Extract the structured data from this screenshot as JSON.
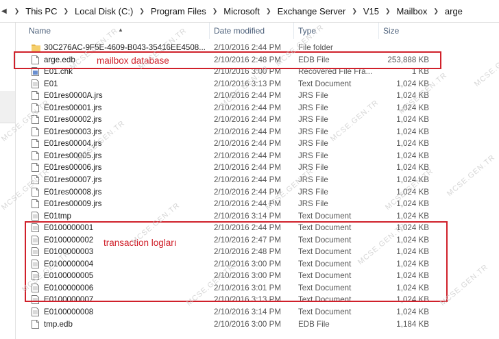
{
  "breadcrumb": [
    "This PC",
    "Local Disk (C:)",
    "Program Files",
    "Microsoft",
    "Exchange Server",
    "V15",
    "Mailbox",
    "arge"
  ],
  "columns": {
    "name": "Name",
    "date": "Date modified",
    "type": "Type",
    "size": "Size"
  },
  "files": [
    {
      "name": "30C276AC-9F5E-4609-B043-35416EE4508...",
      "date": "2/10/2016 2:44 PM",
      "type": "File folder",
      "size": "",
      "icon": "folder-icon"
    },
    {
      "name": "arge.edb",
      "date": "2/10/2016 2:48 PM",
      "type": "EDB File",
      "size": "253,888 KB",
      "icon": "file-icon"
    },
    {
      "name": "E01.chk",
      "date": "2/10/2016 3:00 PM",
      "type": "Recovered File Fra...",
      "size": "1 KB",
      "icon": "recovered-file-icon"
    },
    {
      "name": "E01",
      "date": "2/10/2016 3:13 PM",
      "type": "Text Document",
      "size": "1,024 KB",
      "icon": "text-document-icon"
    },
    {
      "name": "E01res0000A.jrs",
      "date": "2/10/2016 2:44 PM",
      "type": "JRS File",
      "size": "1,024 KB",
      "icon": "file-icon"
    },
    {
      "name": "E01res00001.jrs",
      "date": "2/10/2016 2:44 PM",
      "type": "JRS File",
      "size": "1,024 KB",
      "icon": "file-icon"
    },
    {
      "name": "E01res00002.jrs",
      "date": "2/10/2016 2:44 PM",
      "type": "JRS File",
      "size": "1,024 KB",
      "icon": "file-icon"
    },
    {
      "name": "E01res00003.jrs",
      "date": "2/10/2016 2:44 PM",
      "type": "JRS File",
      "size": "1,024 KB",
      "icon": "file-icon"
    },
    {
      "name": "E01res00004.jrs",
      "date": "2/10/2016 2:44 PM",
      "type": "JRS File",
      "size": "1,024 KB",
      "icon": "file-icon"
    },
    {
      "name": "E01res00005.jrs",
      "date": "2/10/2016 2:44 PM",
      "type": "JRS File",
      "size": "1,024 KB",
      "icon": "file-icon"
    },
    {
      "name": "E01res00006.jrs",
      "date": "2/10/2016 2:44 PM",
      "type": "JRS File",
      "size": "1,024 KB",
      "icon": "file-icon"
    },
    {
      "name": "E01res00007.jrs",
      "date": "2/10/2016 2:44 PM",
      "type": "JRS File",
      "size": "1,024 KB",
      "icon": "file-icon"
    },
    {
      "name": "E01res00008.jrs",
      "date": "2/10/2016 2:44 PM",
      "type": "JRS File",
      "size": "1,024 KB",
      "icon": "file-icon"
    },
    {
      "name": "E01res00009.jrs",
      "date": "2/10/2016 2:44 PM",
      "type": "JRS File",
      "size": "1,024 KB",
      "icon": "file-icon"
    },
    {
      "name": "E01tmp",
      "date": "2/10/2016 3:14 PM",
      "type": "Text Document",
      "size": "1,024 KB",
      "icon": "text-document-icon"
    },
    {
      "name": "E0100000001",
      "date": "2/10/2016 2:44 PM",
      "type": "Text Document",
      "size": "1,024 KB",
      "icon": "text-document-icon"
    },
    {
      "name": "E0100000002",
      "date": "2/10/2016 2:47 PM",
      "type": "Text Document",
      "size": "1,024 KB",
      "icon": "text-document-icon"
    },
    {
      "name": "E0100000003",
      "date": "2/10/2016 2:48 PM",
      "type": "Text Document",
      "size": "1,024 KB",
      "icon": "text-document-icon"
    },
    {
      "name": "E0100000004",
      "date": "2/10/2016 3:00 PM",
      "type": "Text Document",
      "size": "1,024 KB",
      "icon": "text-document-icon"
    },
    {
      "name": "E0100000005",
      "date": "2/10/2016 3:00 PM",
      "type": "Text Document",
      "size": "1,024 KB",
      "icon": "text-document-icon"
    },
    {
      "name": "E0100000006",
      "date": "2/10/2016 3:01 PM",
      "type": "Text Document",
      "size": "1,024 KB",
      "icon": "text-document-icon"
    },
    {
      "name": "E0100000007",
      "date": "2/10/2016 3:13 PM",
      "type": "Text Document",
      "size": "1,024 KB",
      "icon": "text-document-icon"
    },
    {
      "name": "E0100000008",
      "date": "2/10/2016 3:14 PM",
      "type": "Text Document",
      "size": "1,024 KB",
      "icon": "text-document-icon"
    },
    {
      "name": "tmp.edb",
      "date": "2/10/2016 3:00 PM",
      "type": "EDB File",
      "size": "1,184 KB",
      "icon": "file-icon"
    }
  ],
  "annotations": {
    "mailbox_label": "mailbox database",
    "logs_label": "transaction logları",
    "color": "#d0202a"
  },
  "watermark": "MCSE.GEN.TR"
}
